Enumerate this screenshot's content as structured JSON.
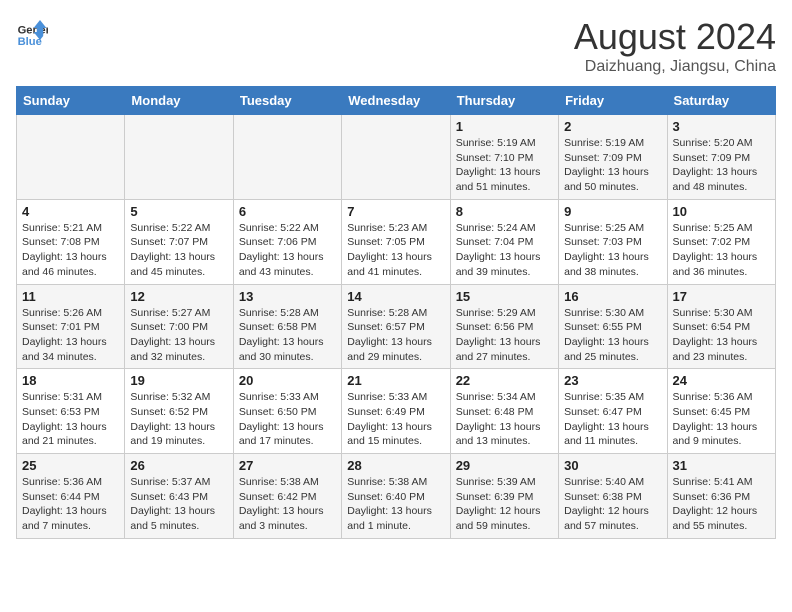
{
  "header": {
    "logo_line1": "General",
    "logo_line2": "Blue",
    "month_year": "August 2024",
    "location": "Daizhuang, Jiangsu, China"
  },
  "weekdays": [
    "Sunday",
    "Monday",
    "Tuesday",
    "Wednesday",
    "Thursday",
    "Friday",
    "Saturday"
  ],
  "weeks": [
    [
      {
        "day": "",
        "info": ""
      },
      {
        "day": "",
        "info": ""
      },
      {
        "day": "",
        "info": ""
      },
      {
        "day": "",
        "info": ""
      },
      {
        "day": "1",
        "info": "Sunrise: 5:19 AM\nSunset: 7:10 PM\nDaylight: 13 hours\nand 51 minutes."
      },
      {
        "day": "2",
        "info": "Sunrise: 5:19 AM\nSunset: 7:09 PM\nDaylight: 13 hours\nand 50 minutes."
      },
      {
        "day": "3",
        "info": "Sunrise: 5:20 AM\nSunset: 7:09 PM\nDaylight: 13 hours\nand 48 minutes."
      }
    ],
    [
      {
        "day": "4",
        "info": "Sunrise: 5:21 AM\nSunset: 7:08 PM\nDaylight: 13 hours\nand 46 minutes."
      },
      {
        "day": "5",
        "info": "Sunrise: 5:22 AM\nSunset: 7:07 PM\nDaylight: 13 hours\nand 45 minutes."
      },
      {
        "day": "6",
        "info": "Sunrise: 5:22 AM\nSunset: 7:06 PM\nDaylight: 13 hours\nand 43 minutes."
      },
      {
        "day": "7",
        "info": "Sunrise: 5:23 AM\nSunset: 7:05 PM\nDaylight: 13 hours\nand 41 minutes."
      },
      {
        "day": "8",
        "info": "Sunrise: 5:24 AM\nSunset: 7:04 PM\nDaylight: 13 hours\nand 39 minutes."
      },
      {
        "day": "9",
        "info": "Sunrise: 5:25 AM\nSunset: 7:03 PM\nDaylight: 13 hours\nand 38 minutes."
      },
      {
        "day": "10",
        "info": "Sunrise: 5:25 AM\nSunset: 7:02 PM\nDaylight: 13 hours\nand 36 minutes."
      }
    ],
    [
      {
        "day": "11",
        "info": "Sunrise: 5:26 AM\nSunset: 7:01 PM\nDaylight: 13 hours\nand 34 minutes."
      },
      {
        "day": "12",
        "info": "Sunrise: 5:27 AM\nSunset: 7:00 PM\nDaylight: 13 hours\nand 32 minutes."
      },
      {
        "day": "13",
        "info": "Sunrise: 5:28 AM\nSunset: 6:58 PM\nDaylight: 13 hours\nand 30 minutes."
      },
      {
        "day": "14",
        "info": "Sunrise: 5:28 AM\nSunset: 6:57 PM\nDaylight: 13 hours\nand 29 minutes."
      },
      {
        "day": "15",
        "info": "Sunrise: 5:29 AM\nSunset: 6:56 PM\nDaylight: 13 hours\nand 27 minutes."
      },
      {
        "day": "16",
        "info": "Sunrise: 5:30 AM\nSunset: 6:55 PM\nDaylight: 13 hours\nand 25 minutes."
      },
      {
        "day": "17",
        "info": "Sunrise: 5:30 AM\nSunset: 6:54 PM\nDaylight: 13 hours\nand 23 minutes."
      }
    ],
    [
      {
        "day": "18",
        "info": "Sunrise: 5:31 AM\nSunset: 6:53 PM\nDaylight: 13 hours\nand 21 minutes."
      },
      {
        "day": "19",
        "info": "Sunrise: 5:32 AM\nSunset: 6:52 PM\nDaylight: 13 hours\nand 19 minutes."
      },
      {
        "day": "20",
        "info": "Sunrise: 5:33 AM\nSunset: 6:50 PM\nDaylight: 13 hours\nand 17 minutes."
      },
      {
        "day": "21",
        "info": "Sunrise: 5:33 AM\nSunset: 6:49 PM\nDaylight: 13 hours\nand 15 minutes."
      },
      {
        "day": "22",
        "info": "Sunrise: 5:34 AM\nSunset: 6:48 PM\nDaylight: 13 hours\nand 13 minutes."
      },
      {
        "day": "23",
        "info": "Sunrise: 5:35 AM\nSunset: 6:47 PM\nDaylight: 13 hours\nand 11 minutes."
      },
      {
        "day": "24",
        "info": "Sunrise: 5:36 AM\nSunset: 6:45 PM\nDaylight: 13 hours\nand 9 minutes."
      }
    ],
    [
      {
        "day": "25",
        "info": "Sunrise: 5:36 AM\nSunset: 6:44 PM\nDaylight: 13 hours\nand 7 minutes."
      },
      {
        "day": "26",
        "info": "Sunrise: 5:37 AM\nSunset: 6:43 PM\nDaylight: 13 hours\nand 5 minutes."
      },
      {
        "day": "27",
        "info": "Sunrise: 5:38 AM\nSunset: 6:42 PM\nDaylight: 13 hours\nand 3 minutes."
      },
      {
        "day": "28",
        "info": "Sunrise: 5:38 AM\nSunset: 6:40 PM\nDaylight: 13 hours\nand 1 minute."
      },
      {
        "day": "29",
        "info": "Sunrise: 5:39 AM\nSunset: 6:39 PM\nDaylight: 12 hours\nand 59 minutes."
      },
      {
        "day": "30",
        "info": "Sunrise: 5:40 AM\nSunset: 6:38 PM\nDaylight: 12 hours\nand 57 minutes."
      },
      {
        "day": "31",
        "info": "Sunrise: 5:41 AM\nSunset: 6:36 PM\nDaylight: 12 hours\nand 55 minutes."
      }
    ]
  ]
}
